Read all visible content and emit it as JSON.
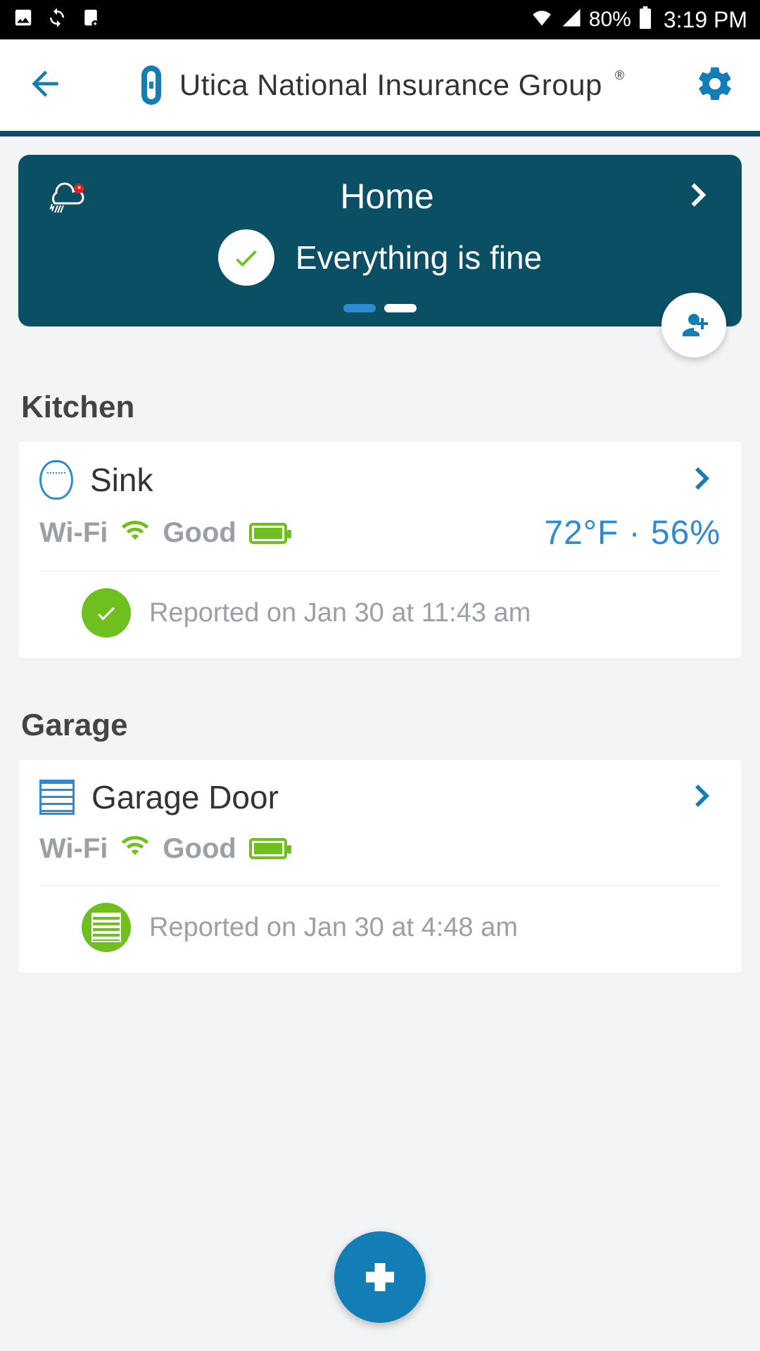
{
  "status_bar": {
    "battery": "80%",
    "time": "3:19 PM"
  },
  "header": {
    "title": "Utica National Insurance Group"
  },
  "hero": {
    "title": "Home",
    "status_text": "Everything is fine"
  },
  "sections": [
    {
      "title": "Kitchen",
      "device": {
        "name": "Sink",
        "wifi_label": "Wi-Fi",
        "battery_label": "Good",
        "readings": "72°F · 56%",
        "reported": "Reported on Jan 30 at 11:43 am",
        "icon": "sensor",
        "status_icon": "check"
      }
    },
    {
      "title": "Garage",
      "device": {
        "name": "Garage Door",
        "wifi_label": "Wi-Fi",
        "battery_label": "Good",
        "readings": "",
        "reported": "Reported on Jan 30 at 4:48 am",
        "icon": "door",
        "status_icon": "door"
      }
    }
  ]
}
